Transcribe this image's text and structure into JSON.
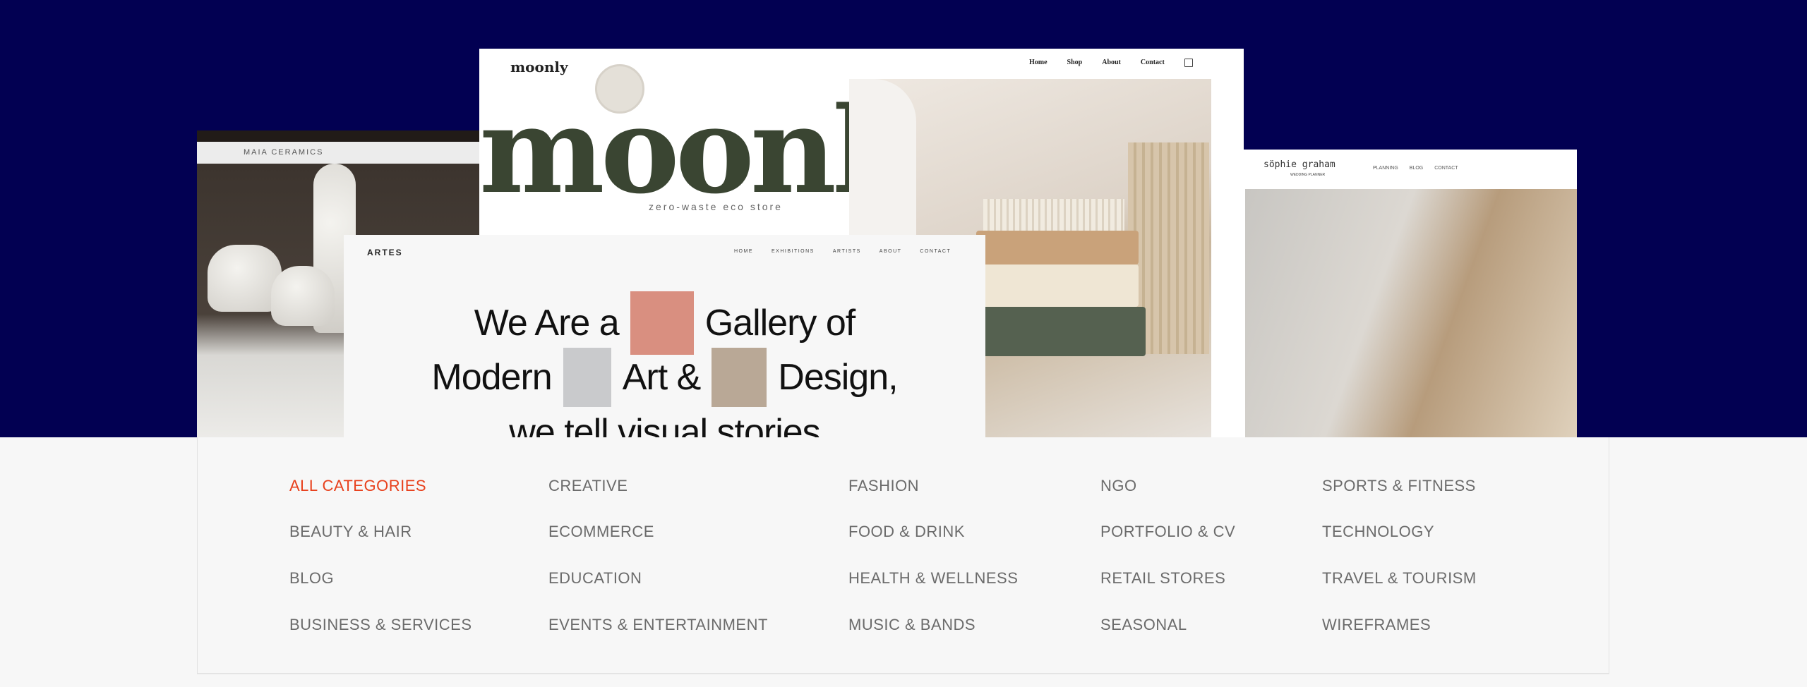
{
  "colors": {
    "hero_bg": "#020052",
    "active": "#e8401c",
    "category_text": "#6b6b6b"
  },
  "previews": {
    "maia": {
      "brand": "MAIA CERAMICS"
    },
    "moonly": {
      "logo": "moonly",
      "nav": [
        "Home",
        "Shop",
        "About",
        "Contact"
      ],
      "cart_icon": "shopping-bag-icon",
      "wordmark": "moonly",
      "tagline": "zero-waste eco store"
    },
    "sophie": {
      "logo": "söphie graham",
      "subtitle": "WEDDING PLANNER",
      "nav": [
        "PLANNING",
        "BLOG",
        "CONTACT"
      ]
    },
    "artes": {
      "logo": "ARTES",
      "nav": [
        "HOME",
        "EXHIBITIONS",
        "ARTISTS",
        "ABOUT",
        "CONTACT"
      ],
      "headline": {
        "l1a": "We Are a",
        "l1b": "Gallery of",
        "l2a": "Modern",
        "l2b": "Art &",
        "l2c": "Design,",
        "l3": "we tell visual stories"
      }
    }
  },
  "categories": [
    [
      "ALL CATEGORIES",
      "BEAUTY & HAIR",
      "BLOG",
      "BUSINESS & SERVICES"
    ],
    [
      "CREATIVE",
      "ECOMMERCE",
      "EDUCATION",
      "EVENTS & ENTERTAINMENT"
    ],
    [
      "FASHION",
      "FOOD & DRINK",
      "HEALTH & WELLNESS",
      "MUSIC & BANDS"
    ],
    [
      "NGO",
      "PORTFOLIO & CV",
      "RETAIL STORES",
      "SEASONAL"
    ],
    [
      "SPORTS & FITNESS",
      "TECHNOLOGY",
      "TRAVEL & TOURISM",
      "WIREFRAMES"
    ]
  ],
  "active_category": "ALL CATEGORIES"
}
